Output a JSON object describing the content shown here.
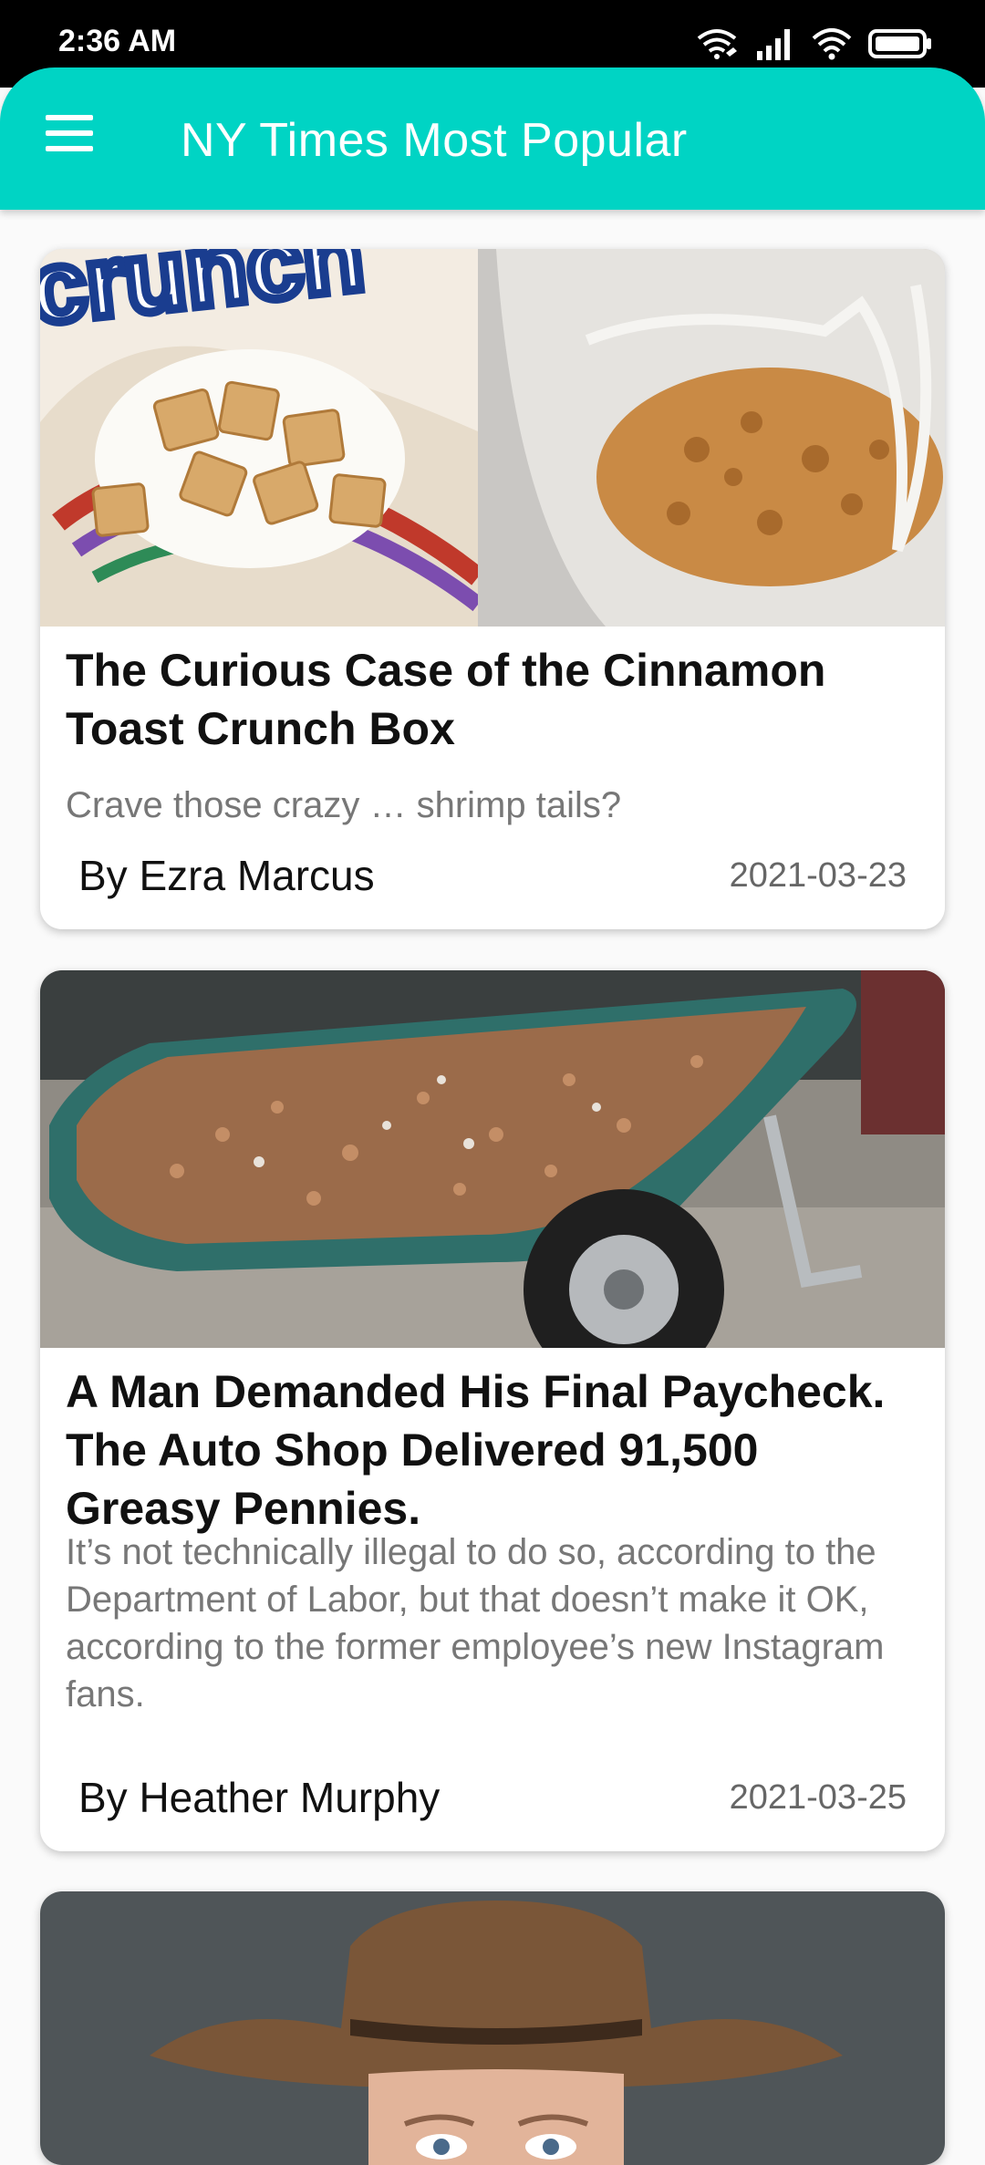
{
  "status_bar": {
    "time": "2:36 AM",
    "icons": [
      "wifi-calling-icon",
      "signal-icon",
      "wifi-icon",
      "battery-icon"
    ]
  },
  "app_bar": {
    "title": "NY Times Most Popular",
    "menu_icon": "menu-icon",
    "color": "#00d4c4"
  },
  "articles": [
    {
      "title": "The Curious Case of the Cinnamon Toast Crunch Box",
      "abstract": "Crave those crazy … shrimp tails?",
      "byline": "By Ezra Marcus",
      "date": "2021-03-23",
      "image_logo_text": "crunch"
    },
    {
      "title": "A Man Demanded His Final Paycheck. The Auto Shop Delivered 91,500 Greasy Pennies.",
      "abstract": "It’s not technically illegal to do so, according to the Department of Labor, but that doesn’t make it OK, according to the former employee’s new Instagram fans.",
      "byline": "By Heather Murphy",
      "date": "2021-03-25"
    },
    {}
  ]
}
